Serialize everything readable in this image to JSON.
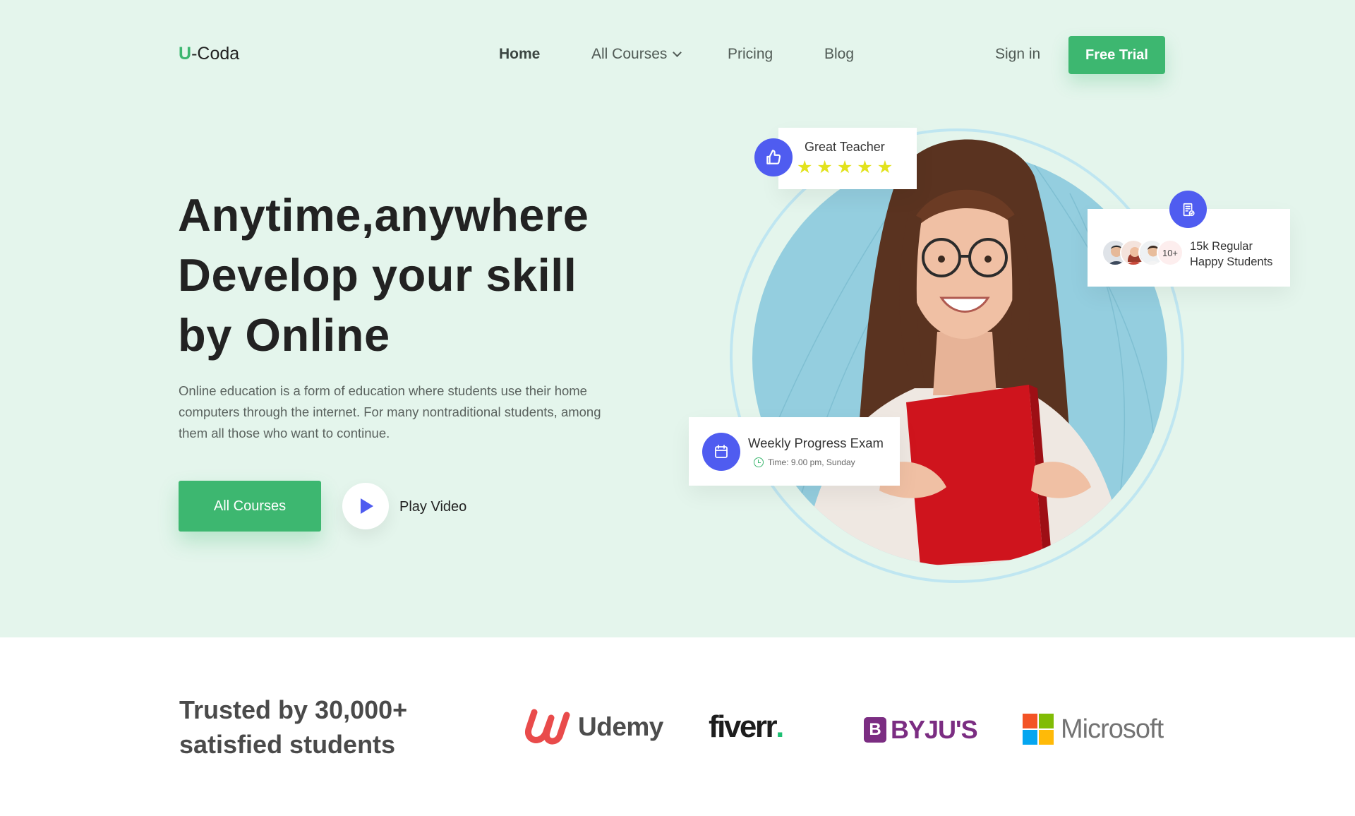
{
  "brand": {
    "prefix": "U",
    "suffix": "-Coda",
    "accent": "#3db770"
  },
  "nav": {
    "home": "Home",
    "all_courses": "All Courses",
    "pricing": "Pricing",
    "blog": "Blog",
    "sign_in": "Sign in",
    "free_trial": "Free Trial"
  },
  "hero": {
    "headline": [
      "Anytime,anywhere",
      "Develop your skill",
      "by Online"
    ],
    "description": "Online education is a form of education where students use their home computers through the internet. For many nontraditional students, among them all those who want to continue.",
    "cta_primary": "All Courses",
    "cta_video": "Play Video"
  },
  "cards": {
    "teacher": {
      "title": "Great Teacher",
      "rating": 5,
      "icon": "thumbs-up-icon"
    },
    "students": {
      "line1": "15k Regular",
      "line2": "Happy Students",
      "more": "10+",
      "icon": "document-check-icon"
    },
    "exam": {
      "title": "Weekly Progress Exam",
      "time": "Time: 9.00 pm, Sunday",
      "icon": "calendar-icon"
    }
  },
  "trusted": {
    "line1": "Trusted by 30,000+",
    "line2": "satisfied students",
    "logos": {
      "udemy": "Udemy",
      "fiverr": "fiverr",
      "fiverr_dot": ".",
      "byjus_mark": "B",
      "byjus": "BYJU'S",
      "microsoft": "Microsoft"
    }
  },
  "colors": {
    "hero_bg": "#e4f5ec",
    "primary": "#3db770",
    "icon_blue": "#4f5cf0",
    "star": "#e2e21c"
  }
}
